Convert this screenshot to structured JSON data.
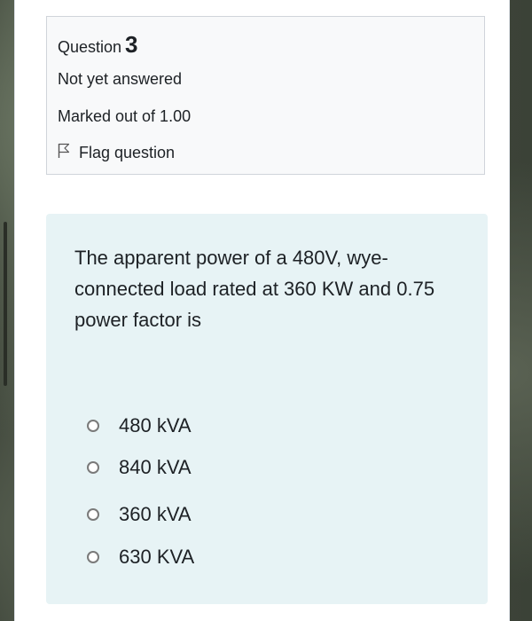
{
  "question": {
    "label": "Question",
    "number": "3",
    "state": "Not yet answered",
    "grade": "Marked out of 1.00",
    "flag_label": "Flag question"
  },
  "content": {
    "text": "The apparent power of a 480V, wye-connected load rated at 360 KW and 0.75 power factor is",
    "options": [
      {
        "label": "480 kVA"
      },
      {
        "label": "840 kVA"
      },
      {
        "label": "360 kVA"
      },
      {
        "label": "630 KVA"
      }
    ]
  },
  "colors": {
    "content_bg": "#e7f3f5",
    "info_bg": "#f8f9fa",
    "text": "#1d2125"
  }
}
